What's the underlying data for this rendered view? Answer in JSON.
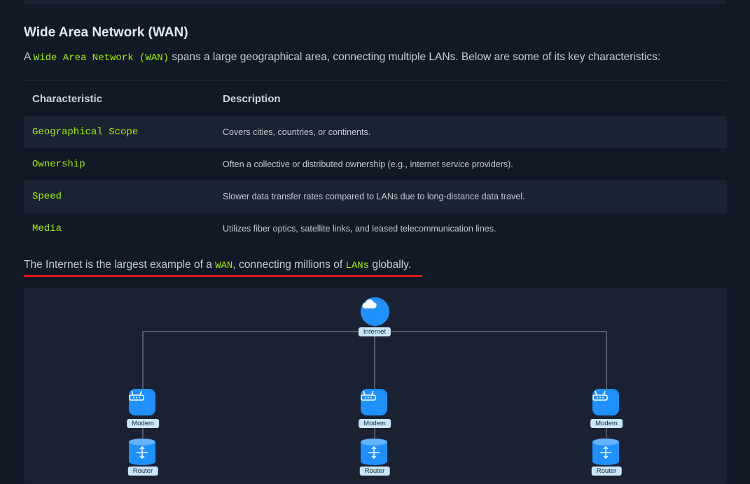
{
  "section": {
    "title": "Wide Area Network (WAN)",
    "intro_prefix": "A ",
    "intro_code": "Wide Area Network (WAN)",
    "intro_suffix": " spans a large geographical area, connecting multiple LANs. Below are some of its key characteristics:"
  },
  "table": {
    "headers": [
      "Characteristic",
      "Description"
    ],
    "rows": [
      {
        "key": "Geographical Scope",
        "value": "Covers cities, countries, or continents."
      },
      {
        "key": "Ownership",
        "value": "Often a collective or distributed ownership (e.g., internet service providers)."
      },
      {
        "key": "Speed",
        "value": "Slower data transfer rates compared to LANs due to long-distance data travel."
      },
      {
        "key": "Media",
        "value": "Utilizes fiber optics, satellite links, and leased telecommunication lines."
      }
    ]
  },
  "note": {
    "part1": "The Internet is the largest example of a ",
    "code1": "WAN",
    "part2": ", connecting millions of ",
    "code2": "LANs",
    "part3": " globally."
  },
  "diagram": {
    "internet_label": "Internet",
    "branches": [
      {
        "modem_label": "Modem",
        "router_label": "Router"
      },
      {
        "modem_label": "Modem",
        "router_label": "Router"
      },
      {
        "modem_label": "Modem",
        "router_label": "Router"
      }
    ],
    "icons": {
      "internet": "cloud-icon",
      "modem": "modem-icon",
      "router": "router-icon"
    },
    "colors": {
      "node": "#1e90ff",
      "label_bg": "#c8e6fb",
      "line": "#8a93a3"
    }
  },
  "colors": {
    "accent_code": "#9fef00",
    "underline": "#e0141c"
  }
}
